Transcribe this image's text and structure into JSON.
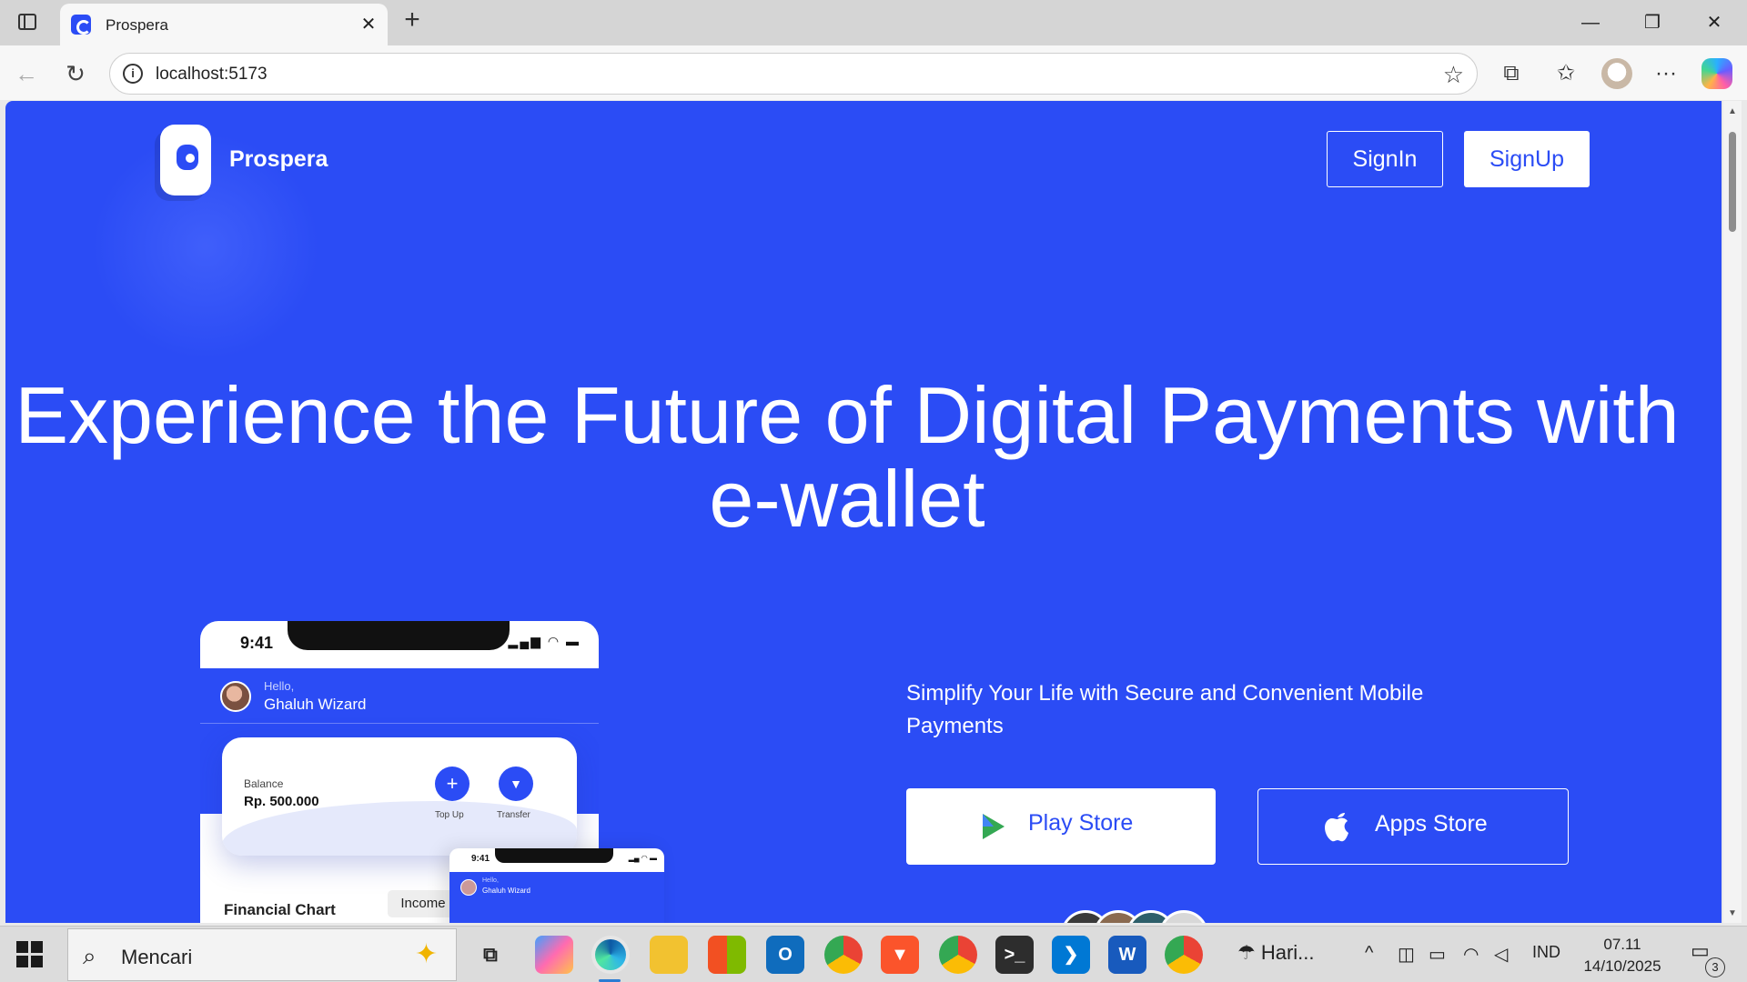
{
  "browser": {
    "tab_title": "Prospera",
    "url": "localhost:5173",
    "close_glyph": "✕",
    "new_tab_glyph": "+",
    "back_glyph": "←",
    "reload_glyph": "↻",
    "star_glyph": "☆",
    "extensions_glyph": "⧉",
    "favorites_glyph": "✩",
    "menu_glyph": "···",
    "minimize_glyph": "—",
    "restore_glyph": "❐",
    "window_close_glyph": "✕",
    "info_glyph": "i"
  },
  "page": {
    "brand": "Prospera",
    "nav": {
      "signin": "SignIn",
      "signup": "SignUp"
    },
    "hero_title": "Experience the Future of Digital Payments with e-wallet",
    "tagline": "Simplify Your Life with Secure and Convenient Mobile Payments",
    "stores": {
      "play": "Play Store",
      "apple": "Apps Store"
    },
    "accent_color": "#2b4cf5"
  },
  "phone": {
    "time": "9:41",
    "hello": "Hello,",
    "name": "Ghaluh Wizard",
    "balance_label": "Balance",
    "balance_value": "Rp. 500.000",
    "top_up": "Top Up",
    "transfer": "Transfer",
    "plus_glyph": "+",
    "send_glyph": "▼",
    "chart_title": "Financial Chart",
    "income_chip": "Income",
    "status_icons": "▂▄▆ ◠ ▬"
  },
  "phone_small": {
    "time": "9:41",
    "hello": "Hello,",
    "name": "Ghaluh Wizard",
    "status_icons": "▂▄ ◠ ▬"
  },
  "taskbar": {
    "search_placeholder": "Mencari",
    "search_glyph": "⌕",
    "spark_glyph": "✦",
    "weather": "Hari...",
    "language": "IND",
    "time": "07.11",
    "date": "14/10/2025",
    "notifications": "3",
    "tray_up_glyph": "^",
    "notif_glyph": "▭"
  }
}
